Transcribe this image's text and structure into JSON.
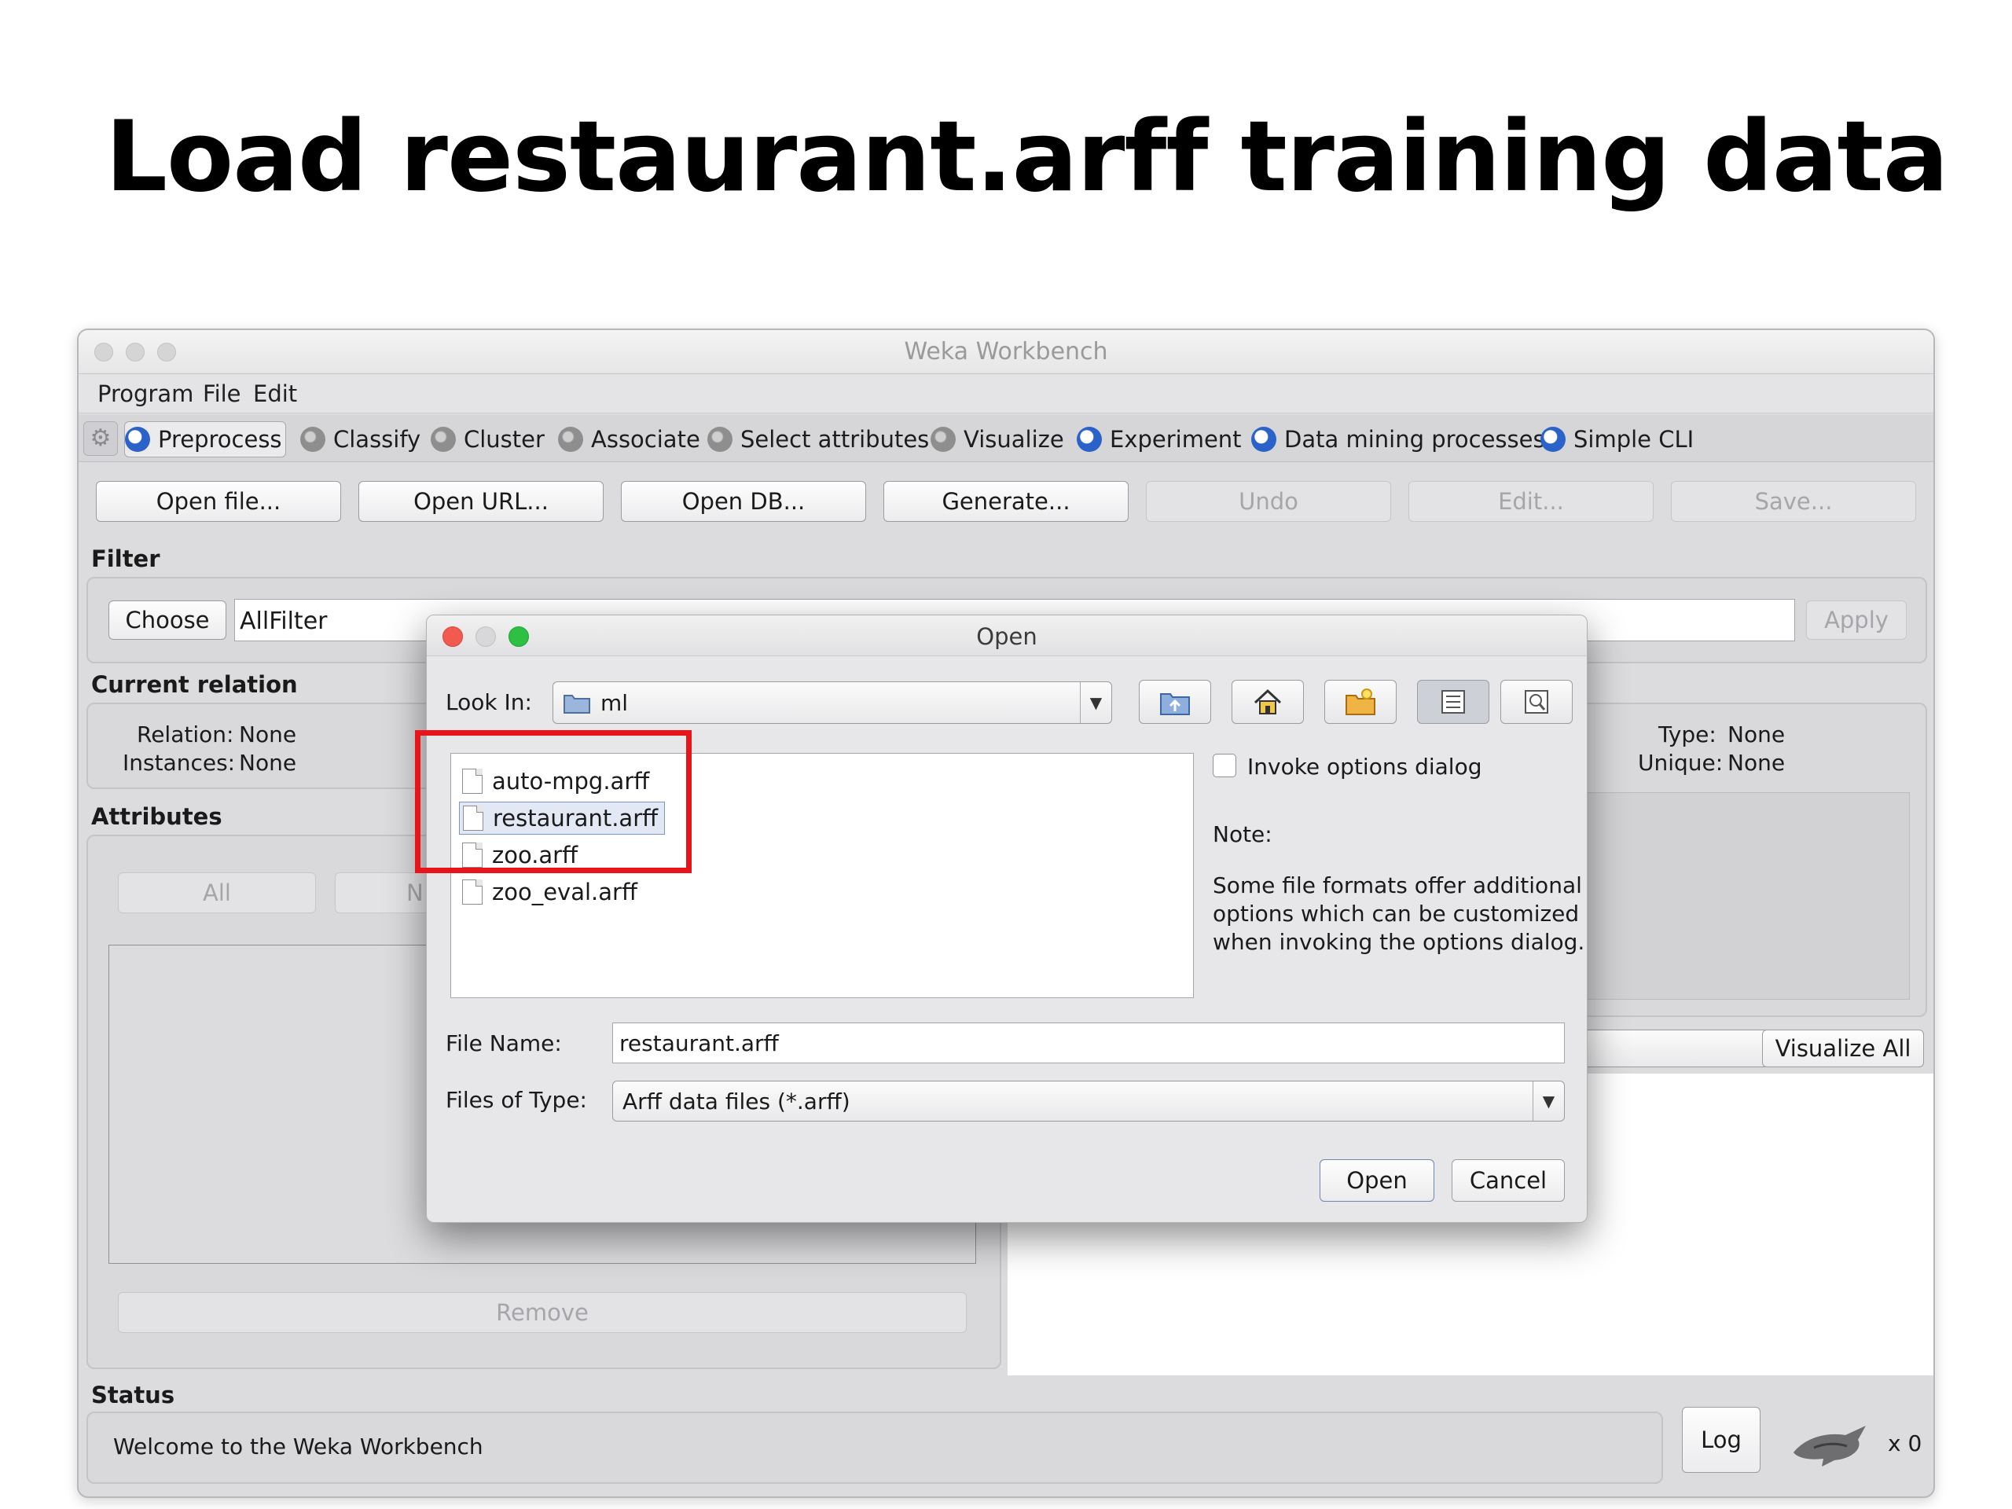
{
  "slide": {
    "title": "Load restaurant.arff training data"
  },
  "window": {
    "title": "Weka Workbench",
    "menu": [
      "Program",
      "File",
      "Edit"
    ],
    "tabs": [
      "Preprocess",
      "Classify",
      "Cluster",
      "Associate",
      "Select attributes",
      "Visualize",
      "Experiment",
      "Data mining processes",
      "Simple CLI"
    ],
    "toolbar": {
      "open_file": "Open file...",
      "open_url": "Open URL...",
      "open_db": "Open DB...",
      "generate": "Generate...",
      "undo": "Undo",
      "edit": "Edit...",
      "save": "Save..."
    },
    "filter": {
      "label": "Filter",
      "choose": "Choose",
      "value": "AllFilter",
      "apply": "Apply"
    },
    "current_relation": {
      "label": "Current relation",
      "relation_label": "Relation:",
      "relation_value": "None",
      "instances_label": "Instances:",
      "instances_value": "None"
    },
    "selected_attribute": {
      "type_label": "Type:",
      "type_value": "None",
      "unique_label": "Unique:",
      "unique_value": "None"
    },
    "attributes": {
      "label": "Attributes",
      "all": "All",
      "none_partial": "N",
      "remove": "Remove"
    },
    "visualize_all": "Visualize All",
    "status": {
      "label": "Status",
      "message": "Welcome to the Weka Workbench",
      "log": "Log",
      "count": "x 0"
    }
  },
  "dialog": {
    "title": "Open",
    "look_in_label": "Look In:",
    "look_in_value": "ml",
    "files": [
      "auto-mpg.arff",
      "restaurant.arff",
      "zoo.arff",
      "zoo_eval.arff"
    ],
    "selected_file": "restaurant.arff",
    "invoke_options": "Invoke options dialog",
    "note_label": "Note:",
    "note_lines": [
      "Some file formats offer additional",
      "options which can be customized",
      "when invoking the options dialog."
    ],
    "file_name_label": "File Name:",
    "file_name_value": "restaurant.arff",
    "files_of_type_label": "Files of Type:",
    "files_of_type_value": "Arff data files (*.arff)",
    "open_button": "Open",
    "cancel_button": "Cancel"
  },
  "colors": {
    "highlight": "#e8141a",
    "accent_blue": "#2a62c9",
    "close_red": "#f25a50",
    "zoom_green": "#2dc043"
  }
}
